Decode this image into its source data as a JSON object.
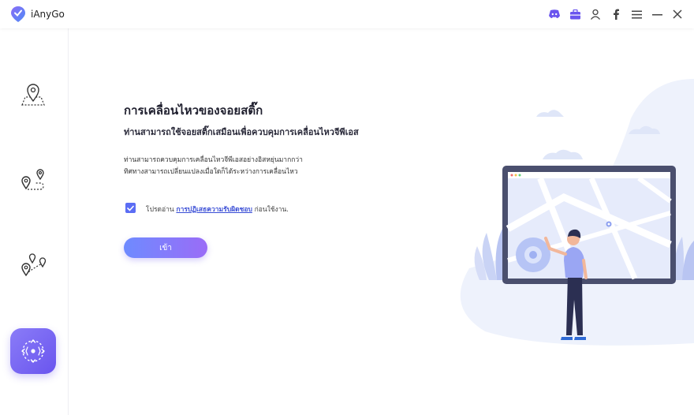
{
  "app": {
    "name": "iAnyGo"
  },
  "titlebar": {
    "icons": [
      "discord-icon",
      "toolbox-icon",
      "user-icon",
      "facebook-icon",
      "menu-icon",
      "minimize-icon",
      "close-icon"
    ]
  },
  "sidebar": {
    "items": [
      {
        "name": "teleport-mode",
        "icon": "location-pin-icon",
        "active": false
      },
      {
        "name": "two-spot-mode",
        "icon": "two-pins-route-icon",
        "active": false
      },
      {
        "name": "multi-spot-mode",
        "icon": "multi-pins-route-icon",
        "active": false
      },
      {
        "name": "joystick-mode",
        "icon": "joystick-icon",
        "active": true
      }
    ]
  },
  "main": {
    "title": "การเคลื่อนไหวของจอยสติ๊ก",
    "subtitle": "ท่านสามารถใช้จอยสติ๊กเสมือนเพื่อควบคุมการเคลื่อนไหวจีพีเอส",
    "desc_line1": "ท่านสามารถควบคุมการเคลื่อนไหวจีพีเอสอย่างอิสหยุ่นมากกว่า",
    "desc_line2": "ทิศทางสามารถเปลี่ยนแปลงเมื่อใดก็ได้ระหว่างการเคลื่อนไหว",
    "agree_prefix": "โปรดอ่าน ",
    "agree_link": "การปฏิเสธความรับผิดชอบ",
    "agree_suffix": " ก่อนใช้งาน.",
    "agree_checked": true,
    "enter_button": "เข้า"
  },
  "colors": {
    "accent": "#6a55ee",
    "link": "#3b4fd6",
    "button_start": "#6e8bff",
    "button_end": "#9a6cf7"
  }
}
